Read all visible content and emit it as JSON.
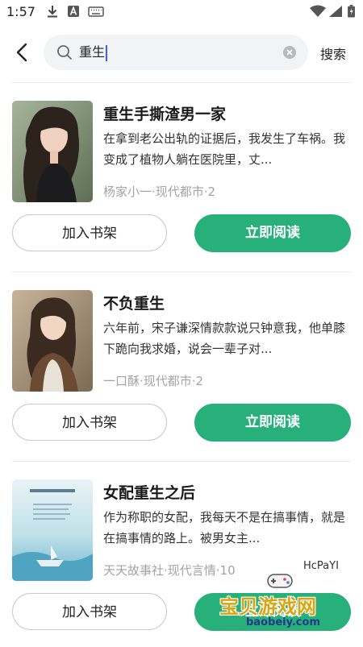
{
  "status_bar": {
    "time": "1:57",
    "left_icons": [
      "download-icon",
      "app-a-icon",
      "keyboard-icon"
    ],
    "right_icons": [
      "wifi-icon",
      "signal-icon",
      "battery-icon"
    ]
  },
  "search": {
    "back_icon": "chevron-left-icon",
    "query": "重生",
    "clear_icon": "clear-icon",
    "submit_label": "搜索"
  },
  "books": [
    {
      "title": "重生手撕渣男一家",
      "description": "在拿到老公出轨的证据后，我发生了车祸。我变成了植物人躺在医院里，丈...",
      "meta": "杨家小一·现代都市·2",
      "add_label": "加入书架",
      "read_label": "立即阅读"
    },
    {
      "title": "不负重生",
      "description": "六年前，宋子谦深情款款说只钟意我，他单膝下跪向我求婚，说会一辈子对...",
      "meta": "一口酥·现代都市·2",
      "add_label": "加入书架",
      "read_label": "立即阅读"
    },
    {
      "title": "女配重生之后",
      "description": "作为称职的女配，我每天不是在搞事情，就是在搞事情的路上。被男女主...",
      "meta": "天天故事社·现代言情·10",
      "add_label": "加入书架",
      "read_label": "立即阅读"
    }
  ],
  "watermark": {
    "user": "HcPaYI",
    "site": "宝贝游戏网",
    "domain": "baobeiy.com"
  },
  "colors": {
    "accent": "#27b07a",
    "meta_text": "#a3a3a3",
    "search_bg": "#f2f3f5"
  }
}
